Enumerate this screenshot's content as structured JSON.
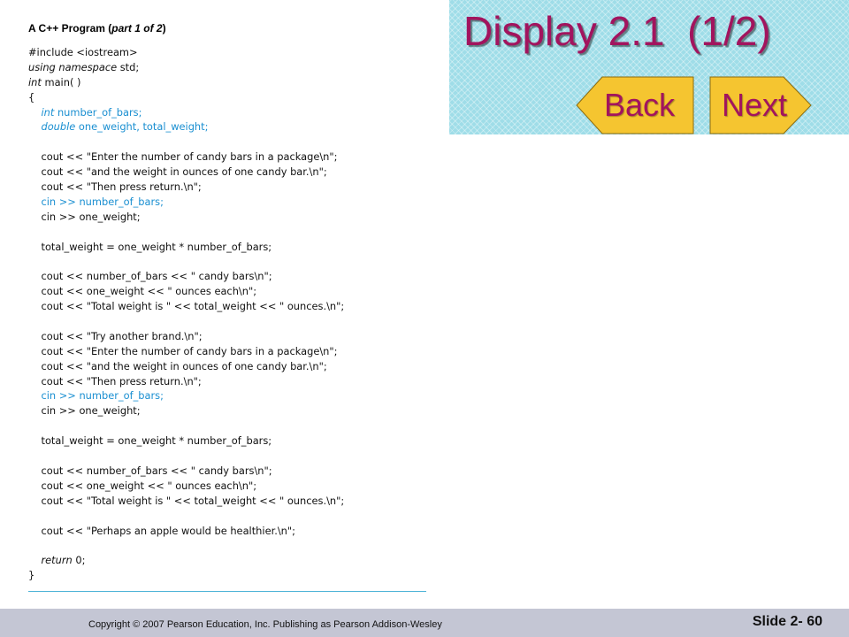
{
  "slide": {
    "title": "Display 2.1  (1/2)",
    "back_label": "Back",
    "next_label": "Next"
  },
  "code": {
    "heading_prefix": "A C++ Program (",
    "heading_italic": "part 1 of 2",
    "heading_suffix": ")",
    "lines": [
      {
        "text": "#include <iostream>"
      },
      {
        "text": "using namespace std;",
        "kw": "using namespace"
      },
      {
        "text": "int main( )",
        "kw": "int"
      },
      {
        "text": "{"
      },
      {
        "text": "    int number_of_bars;",
        "kw": "int",
        "color": "blue"
      },
      {
        "text": "    double one_weight, total_weight;",
        "kw": "double",
        "color": "blue"
      },
      {
        "text": ""
      },
      {
        "text": "    cout << \"Enter the number of candy bars in a package\\n\";"
      },
      {
        "text": "    cout << \"and the weight in ounces of one candy bar.\\n\";"
      },
      {
        "text": "    cout << \"Then press return.\\n\";"
      },
      {
        "text": "    cin >> number_of_bars;",
        "color": "blue"
      },
      {
        "text": "    cin >> one_weight;"
      },
      {
        "text": ""
      },
      {
        "text": "    total_weight = one_weight * number_of_bars;"
      },
      {
        "text": ""
      },
      {
        "text": "    cout << number_of_bars << \" candy bars\\n\";"
      },
      {
        "text": "    cout << one_weight << \" ounces each\\n\";"
      },
      {
        "text": "    cout << \"Total weight is \" << total_weight << \" ounces.\\n\";"
      },
      {
        "text": ""
      },
      {
        "text": "    cout << \"Try another brand.\\n\";"
      },
      {
        "text": "    cout << \"Enter the number of candy bars in a package\\n\";"
      },
      {
        "text": "    cout << \"and the weight in ounces of one candy bar.\\n\";"
      },
      {
        "text": "    cout << \"Then press return.\\n\";"
      },
      {
        "text": "    cin >> number_of_bars;",
        "color": "blue"
      },
      {
        "text": "    cin >> one_weight;"
      },
      {
        "text": ""
      },
      {
        "text": "    total_weight = one_weight * number_of_bars;"
      },
      {
        "text": ""
      },
      {
        "text": "    cout << number_of_bars << \" candy bars\\n\";"
      },
      {
        "text": "    cout << one_weight << \" ounces each\\n\";"
      },
      {
        "text": "    cout << \"Total weight is \" << total_weight << \" ounces.\\n\";"
      },
      {
        "text": ""
      },
      {
        "text": "    cout << \"Perhaps an apple would be healthier.\\n\";"
      },
      {
        "text": ""
      },
      {
        "text": "    return 0;",
        "kw": "return"
      },
      {
        "text": "}"
      }
    ]
  },
  "footer": {
    "copyright": "Copyright © 2007 Pearson Education, Inc. Publishing as Pearson Addison-Wesley",
    "slide_number": "Slide 2- 60"
  },
  "colors": {
    "title": "#a2145e",
    "panel": "#9fdde8",
    "button_fill": "#f5c530",
    "code_highlight": "#1a8fd1",
    "footer": "#c4c6d4"
  }
}
